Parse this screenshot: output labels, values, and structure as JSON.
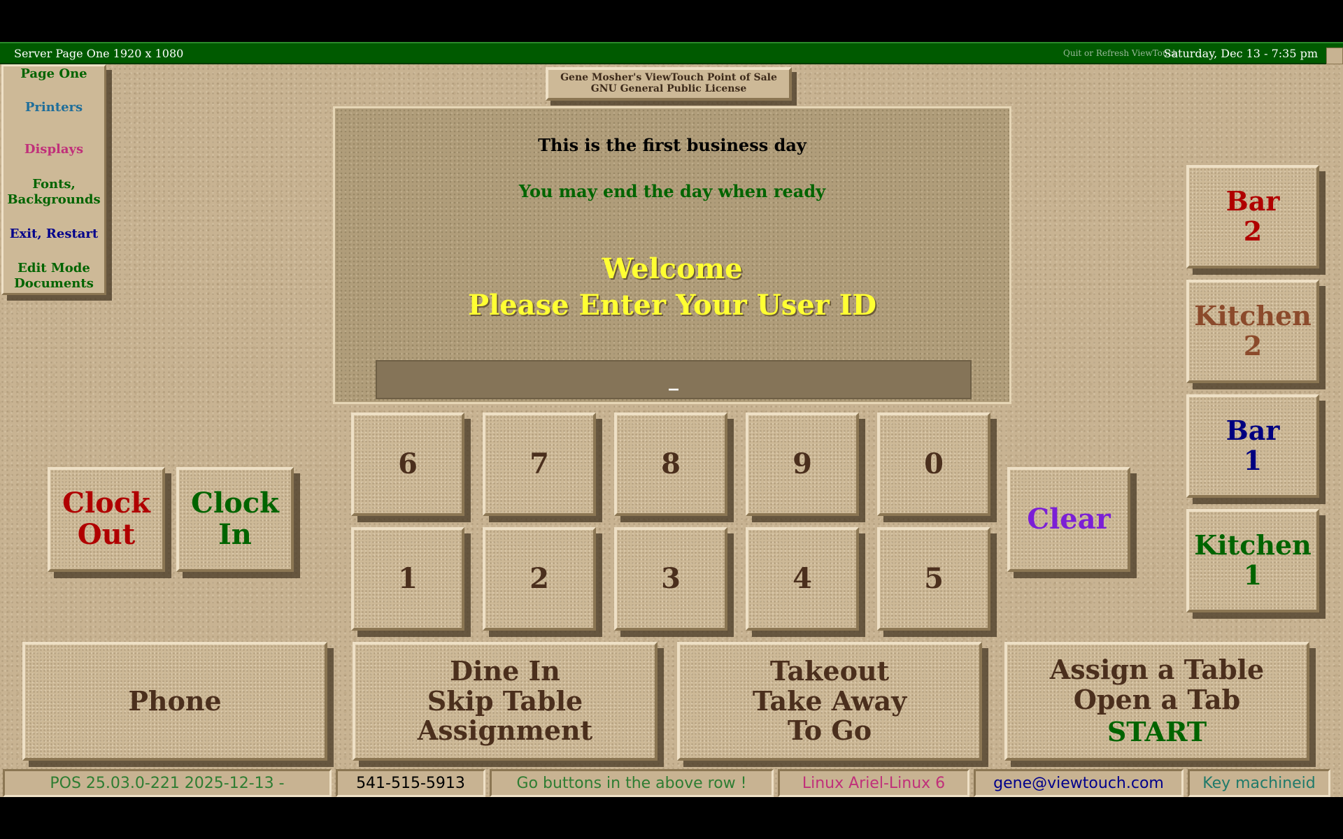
{
  "titlebar": {
    "left": "Server Page One 1920 x 1080",
    "quit": "Quit or Refresh ViewTouch",
    "datetime": "Saturday, Dec 13 - 7:35 pm"
  },
  "menu": {
    "page_one": "Page One",
    "printers": "Printers",
    "displays": "Displays",
    "fonts_line1": "Fonts,",
    "fonts_line2": "Backgrounds",
    "exit": "Exit, Restart",
    "edit_line1": "Edit Mode",
    "edit_line2": "Documents"
  },
  "license": {
    "line1": "Gene Mosher's ViewTouch  Point of Sale",
    "line2": "GNU General Public License"
  },
  "panel": {
    "first_day": "This is the first business day",
    "end_day": "You may end the day when ready",
    "welcome": "Welcome",
    "prompt": "Please Enter Your User ID",
    "entry_value": "_"
  },
  "keypad": {
    "row1": [
      "6",
      "7",
      "8",
      "9",
      "0"
    ],
    "row2": [
      "1",
      "2",
      "3",
      "4",
      "5"
    ],
    "clear": "Clear"
  },
  "clock": {
    "out_line1": "Clock",
    "out_line2": "Out",
    "in_line1": "Clock",
    "in_line2": "In"
  },
  "stations": {
    "bar2_line1": "Bar",
    "bar2_line2": "2",
    "kitchen2_line1": "Kitchen",
    "kitchen2_line2": "2",
    "bar1_line1": "Bar",
    "bar1_line2": "1",
    "kitchen1_line1": "Kitchen",
    "kitchen1_line2": "1"
  },
  "go_row": {
    "phone": "Phone",
    "dine_line1": "Dine In",
    "dine_line2": "Skip Table",
    "dine_line3": "Assignment",
    "takeout_line1": "Takeout",
    "takeout_line2": "Take Away",
    "takeout_line3": "To Go",
    "assign_line1": "Assign a Table",
    "assign_line2": "Open a Tab",
    "assign_line3": "START"
  },
  "footer": {
    "version": "POS 25.03.0-221 2025-12-13 -",
    "phone": "541-515-5913",
    "go_hint": "Go buttons in the above row !",
    "os": "Linux Ariel-Linux 6",
    "email": "gene@viewtouch.com",
    "key": "Key machineid"
  },
  "colors": {
    "title_green": "#005a00",
    "brown_text": "#4b2f1d",
    "red": "#b00000",
    "green": "#006400",
    "navy": "#000080",
    "purple": "#7b1fd6",
    "yellow": "#ffff33"
  }
}
